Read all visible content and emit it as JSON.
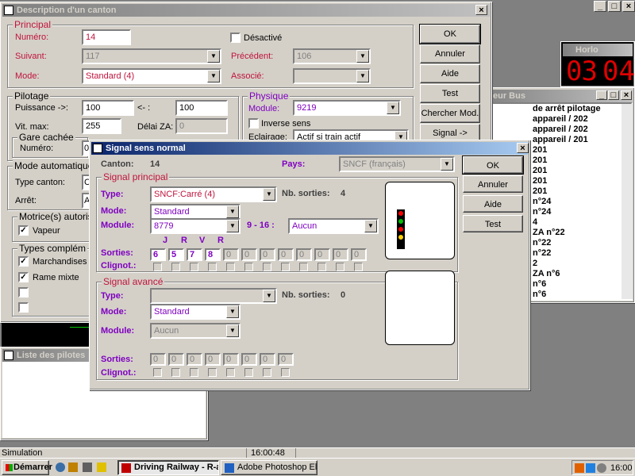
{
  "desktop": {
    "controls": {
      "min": "_",
      "max": "□",
      "close": "×"
    },
    "status_left": "Simulation",
    "status_time": "16:00:48"
  },
  "main_window": {
    "title": "Description d'un canton",
    "close": "×",
    "principal": {
      "title": "Principal",
      "numero_label": "Numéro:",
      "numero_value": "14",
      "desactive_label": "Désactivé",
      "suivant_label": "Suivant:",
      "suivant_value": "117",
      "precedent_label": "Précédent:",
      "precedent_value": "106",
      "mode_label": "Mode:",
      "mode_value": "Standard (4)",
      "associe_label": "Associé:",
      "associe_value": ""
    },
    "pilotage": {
      "title": "Pilotage",
      "puissance_label": "Puissance ->:",
      "puissance_value": "100",
      "back_label": "<- :",
      "back_value": "100",
      "vitmax_label": "Vit. max:",
      "vitmax_value": "255",
      "delai_label": "Délai ZA:",
      "delai_value": "0"
    },
    "gare": {
      "title": "Gare cachée",
      "numero_label": "Numéro:",
      "numero_value": "0"
    },
    "physique": {
      "title": "Physique",
      "module_label": "Module:",
      "module_value": "9219",
      "inverse_label": "Inverse sens",
      "eclairage_label": "Eclairage:",
      "eclairage_value": "Actif si train actif"
    },
    "mode_auto": {
      "title": "Mode automatique",
      "type_label": "Type canton:",
      "type_value": "C",
      "arret_label": "Arrêt:",
      "arret_value": "A"
    },
    "motrices": {
      "title": "Motrice(s) autoris",
      "vapeur": "Vapeur"
    },
    "types": {
      "title": "Types complém",
      "marchandises": "Marchandises",
      "rame": "Rame mixte"
    },
    "buttons": {
      "ok": "OK",
      "annuler": "Annuler",
      "aide": "Aide",
      "test": "Test",
      "chercher": "Chercher Mod.",
      "signal": "Signal ->"
    }
  },
  "clock": {
    "title": "Horlo",
    "time_h": "03",
    "time_m": "04",
    "color": "#e00000"
  },
  "bus_window": {
    "title": "eur Bus",
    "items": [
      "de arrêt pilotage",
      "appareil / 202",
      "appareil / 202",
      "appareil / 201",
      "201",
      "201",
      "201",
      "201",
      "201",
      "n°24",
      "n°24",
      "4",
      "ZA n°22",
      "n°22",
      "n°22",
      "2",
      "ZA n°6",
      "n°6",
      "n°6"
    ]
  },
  "pilots_window": {
    "title": "Liste des pilotes"
  },
  "signal_dialog": {
    "title": "Signal sens normal",
    "close": "×",
    "canton_label": "Canton:",
    "canton_value": "14",
    "pays_label": "Pays:",
    "pays_value": "SNCF (français)",
    "principal": {
      "title": "Signal principal",
      "type_label": "Type:",
      "type_value": "SNCF:Carré (4)",
      "nbs_label": "Nb. sorties:",
      "nbs_value": "4",
      "mode_label": "Mode:",
      "mode_value": "Standard",
      "module_label": "Module:",
      "module_value": "8779",
      "range_label": "9 - 16 :",
      "range_value": "Aucun",
      "letters": [
        "J",
        "R",
        "V",
        "R"
      ],
      "sorties_label": "Sorties:",
      "sorties": [
        "6",
        "5",
        "7",
        "8",
        "0",
        "0",
        "0",
        "0",
        "0",
        "0",
        "0",
        "0"
      ],
      "clignot_label": "Clignot.:"
    },
    "avance": {
      "title": "Signal avancé",
      "type_label": "Type:",
      "type_value": "",
      "nbs_label": "Nb. sorties:",
      "nbs_value": "0",
      "mode_label": "Mode:",
      "mode_value": "Standard",
      "module_label": "Module:",
      "module_value": "Aucun",
      "sorties_label": "Sorties:",
      "sorties": [
        "0",
        "0",
        "0",
        "0",
        "0",
        "0",
        "0",
        "0"
      ],
      "clignot_label": "Clignot.:"
    },
    "buttons": {
      "ok": "OK",
      "annuler": "Annuler",
      "aide": "Aide",
      "test": "Test"
    },
    "lamp_colors": [
      "#ff0000",
      "#00c000",
      "#ff0000",
      "#ffd000"
    ]
  },
  "taskbar": {
    "start": "Démarrer",
    "tasks": [
      "Driving Railway - R-ar...",
      "Adobe Photoshop Elements"
    ],
    "time": "16:00"
  }
}
